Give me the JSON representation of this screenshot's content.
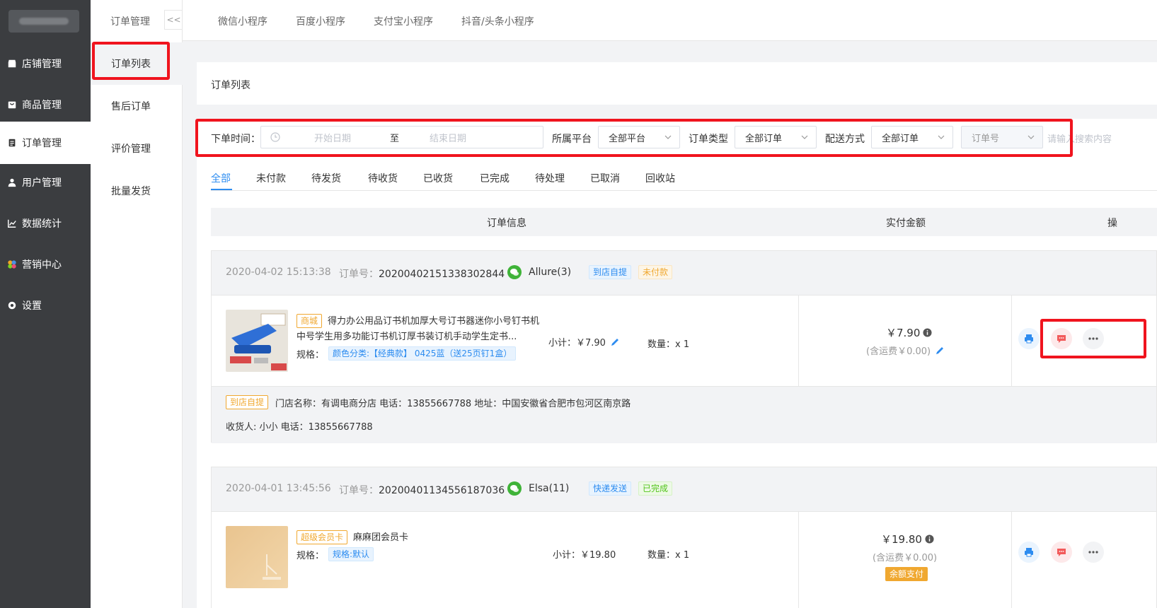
{
  "sidebar": {
    "items": [
      {
        "label": "店铺管理",
        "icon": "store-icon"
      },
      {
        "label": "商品管理",
        "icon": "goods-icon"
      },
      {
        "label": "订单管理",
        "icon": "order-icon"
      },
      {
        "label": "用户管理",
        "icon": "user-icon"
      },
      {
        "label": "数据统计",
        "icon": "chart-icon"
      },
      {
        "label": "营销中心",
        "icon": "marketing-icon"
      },
      {
        "label": "设置",
        "icon": "settings-icon"
      }
    ]
  },
  "subnav": {
    "title": "订单管理",
    "collapse_label": "<<",
    "items": [
      "订单列表",
      "售后订单",
      "评价管理",
      "批量发货"
    ]
  },
  "topbar": {
    "tabs": [
      "微信小程序",
      "百度小程序",
      "支付宝小程序",
      "抖音/头条小程序"
    ]
  },
  "page": {
    "title": "订单列表"
  },
  "filters": {
    "time_label": "下单时间：",
    "start_placeholder": "开始日期",
    "range_sep": "至",
    "end_placeholder": "结束日期",
    "platform_label": "所属平台",
    "platform_value": "全部平台",
    "type_label": "订单类型",
    "type_value": "全部订单",
    "delivery_label": "配送方式",
    "delivery_value": "全部订单",
    "field_value": "订单号",
    "search_placeholder": "请输入搜索内容"
  },
  "status_tabs": [
    "全部",
    "未付款",
    "待发货",
    "待收货",
    "已收货",
    "已完成",
    "待处理",
    "已取消",
    "回收站"
  ],
  "table_header": {
    "info": "订单信息",
    "amount": "实付金额",
    "action": "操"
  },
  "orders": [
    {
      "time": "2020-04-02 15:13:38",
      "order_no_label": "订单号：",
      "order_no": "20200402151338302844",
      "user": "Allure(3)",
      "delivery_tag": "到店自提",
      "status_tag": "未付款",
      "goods_tag": "商城",
      "goods_name": "得力办公用品订书机加厚大号订书器迷你小号钉书机中号学生用多功能订书机订厚书装订机手动学生定书...",
      "spec_label": "规格：",
      "spec_value": "颜色分类:【经典款】 0425蓝（送25页钉1盒）",
      "subtotal": "小计：￥7.90",
      "qty": "数量：x 1",
      "price": "￥7.90",
      "freight": "(含运费￥0.00)",
      "foot_tag": "到店自提",
      "store_info": "门店名称：有调电商分店 电话：13855667788 地址：中国安徽省合肥市包河区南京路",
      "receiver": "收货人: 小小 电话：13855667788"
    },
    {
      "time": "2020-04-01 13:45:56",
      "order_no_label": "订单号：",
      "order_no": "20200401134556187036",
      "user": "Elsa(11)",
      "delivery_tag": "快递发送",
      "status_tag": "已完成",
      "goods_tag": "超级会员卡",
      "goods_name": "麻麻团会员卡",
      "spec_label": "规格：",
      "spec_value": "规格:默认",
      "subtotal": "小计：￥19.80",
      "qty": "数量：x 1",
      "price": "￥19.80",
      "freight": "(含运费￥0.00)",
      "pay_tag": "余额支付"
    }
  ],
  "colors": {
    "sidebar_bg": "#3b3d40",
    "accent": "#2d8cf0",
    "highlight": "#f0141e"
  }
}
